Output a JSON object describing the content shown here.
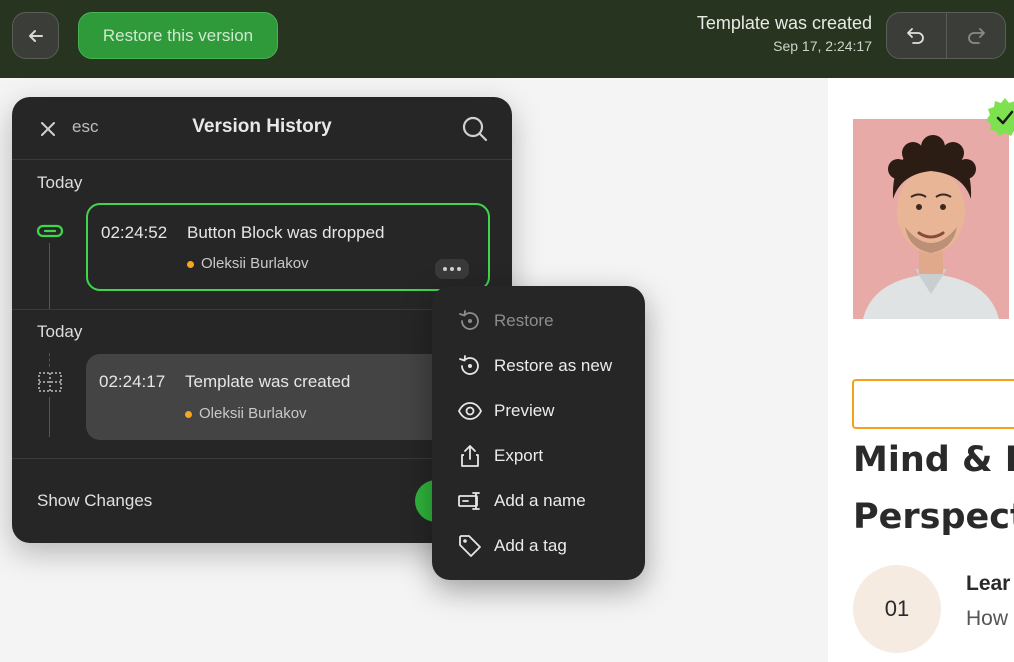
{
  "topbar": {
    "restore_label": "Restore this version",
    "history_title": "Template was created",
    "history_time": "Sep 17, 2:24:17"
  },
  "panel": {
    "esc_label": "esc",
    "title": "Version History",
    "groups": [
      {
        "label": "Today",
        "entry": {
          "time": "02:24:52",
          "label": "Button Block was dropped",
          "author": "Oleksii Burlakov"
        }
      },
      {
        "label": "Today",
        "entry": {
          "time": "02:24:17",
          "label": "Template was created",
          "author": "Oleksii Burlakov"
        }
      }
    ],
    "show_changes_label": "Show Changes"
  },
  "menu": {
    "items": [
      {
        "label": "Restore",
        "icon": "restore-icon",
        "disabled": true
      },
      {
        "label": "Restore as new",
        "icon": "restore-new-icon"
      },
      {
        "label": "Preview",
        "icon": "eye-icon"
      },
      {
        "label": "Export",
        "icon": "export-icon"
      },
      {
        "label": "Add a name",
        "icon": "rename-icon"
      },
      {
        "label": "Add a tag",
        "icon": "tag-icon"
      }
    ]
  },
  "canvas": {
    "heading_line1": "Mind & Le",
    "heading_line2": "Perspectiv",
    "step_number": "01",
    "learn_title": "Lear",
    "learn_sub": "How"
  },
  "colors": {
    "topbar": "#27341f",
    "accent_green": "#3fd64c",
    "author_dot": "#f5a623",
    "input_outline": "#f2a31b"
  }
}
